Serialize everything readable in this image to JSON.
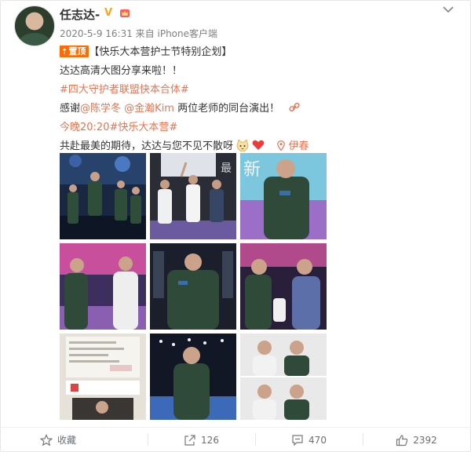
{
  "post": {
    "username": "任志达-",
    "verified_icon": "verified-v-icon",
    "meta": "2020-5-9 16:31 来自 iPhone客户端",
    "pin_label": "置顶",
    "lines": {
      "title": "【快乐大本营护士节特别企划】",
      "line1": "达达高清大图分享来啦！！",
      "hashtag1": "#四大守护者联盟快本合体#",
      "thanks_prefix": "感谢",
      "mention1": "@陈学冬",
      "mention2": "@金瀚Kim",
      "thanks_suffix": " 两位老师的同台演出！",
      "hashtag2": "今晚20:20#快乐大本营#",
      "line_last": "共赴最美的期待，达达与您不见不散呀",
      "location": "伊春"
    }
  },
  "footer": {
    "favorite_label": "收藏",
    "repost_count": "126",
    "comment_count": "470",
    "like_count": "2392"
  },
  "colors": {
    "link": "#eb7350",
    "pin": "#ff6b00",
    "meta": "#808080"
  }
}
